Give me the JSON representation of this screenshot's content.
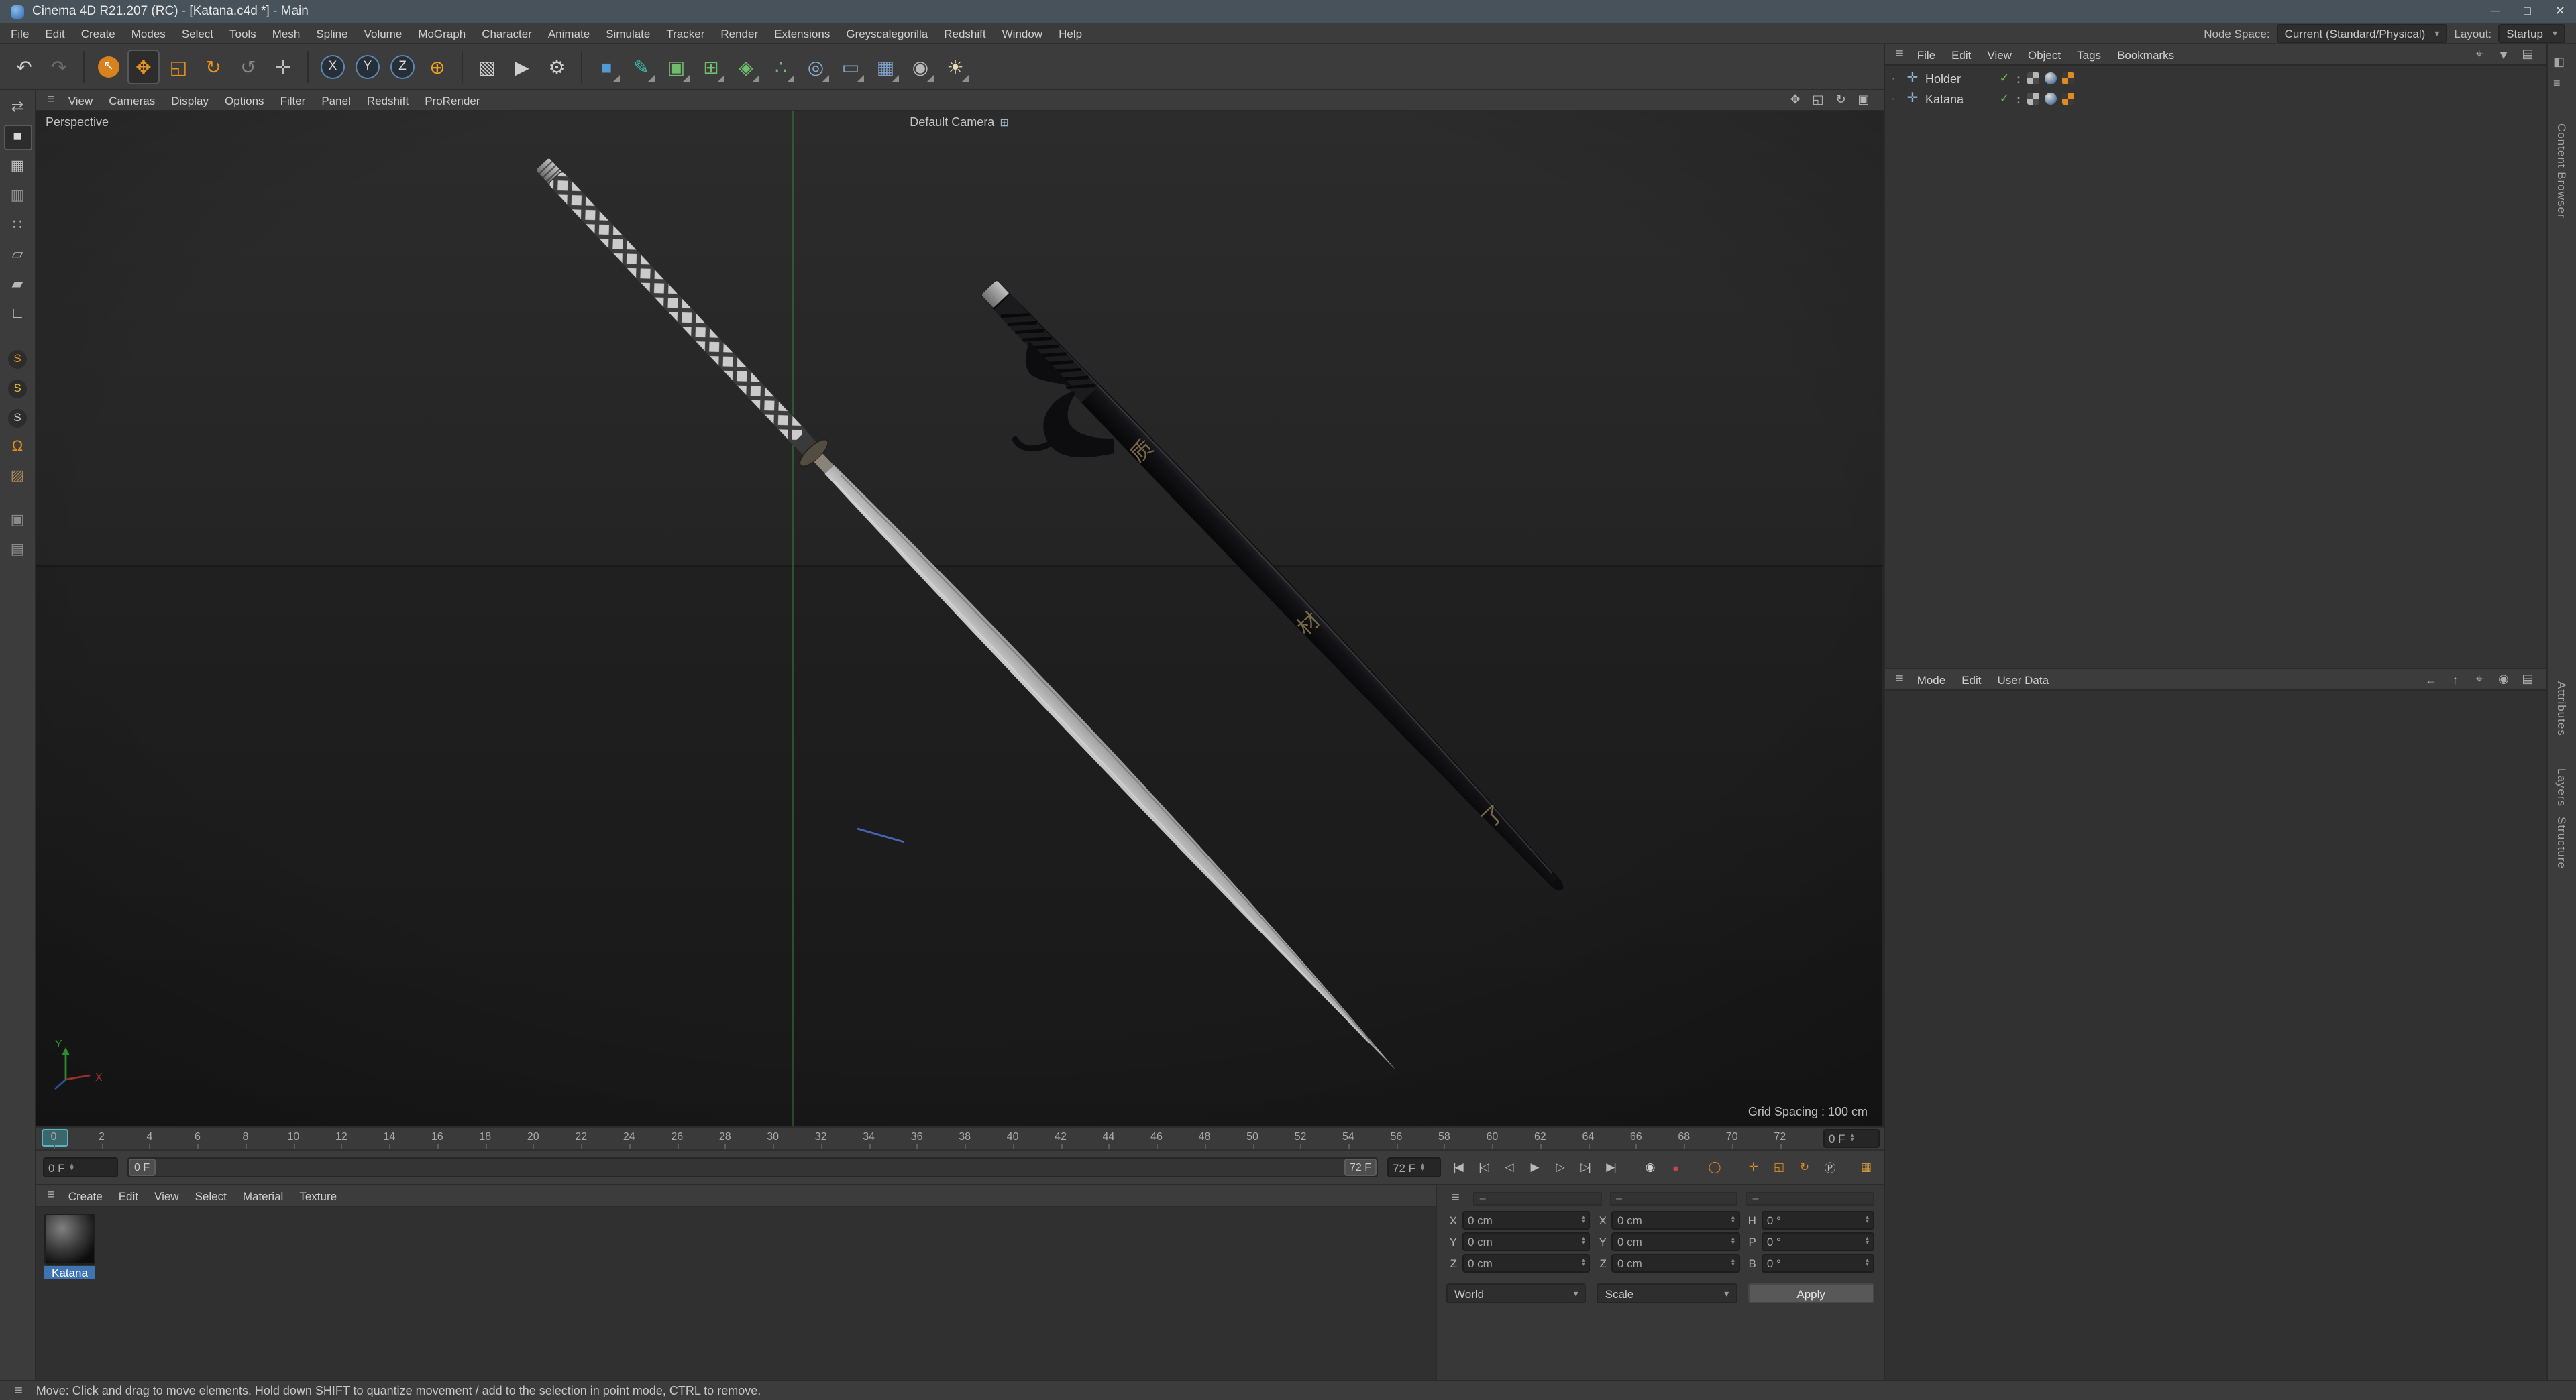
{
  "ui": {
    "hamburger": "≡",
    "dropdown_arrow": "▾",
    "stepper_up": "▴",
    "stepper_down": "▾"
  },
  "titlebar": {
    "title": "Cinema 4D R21.207 (RC) - [Katana.c4d *] - Main",
    "minimize": "─",
    "maximize": "□",
    "close": "✕"
  },
  "menubar": {
    "items": [
      "File",
      "Edit",
      "Create",
      "Modes",
      "Select",
      "Tools",
      "Mesh",
      "Spline",
      "Volume",
      "MoGraph",
      "Character",
      "Animate",
      "Simulate",
      "Tracker",
      "Render",
      "Extensions",
      "Greyscalegorilla",
      "Redshift",
      "Window",
      "Help"
    ],
    "node_space_label": "Node Space:",
    "node_space_value": "Current (Standard/Physical)",
    "layout_label": "Layout:",
    "layout_value": "Startup"
  },
  "toolbar": {
    "icons": [
      {
        "name": "undo-icon",
        "glyph": "↶",
        "fg": "#cfcfcf"
      },
      {
        "name": "redo-icon",
        "glyph": "↷",
        "fg": "#6e6e6e"
      },
      {
        "sep": true
      },
      {
        "name": "live-selection-tool",
        "glyph": "↖",
        "fg": "#ffffff",
        "bg": "#d8821e",
        "shape": "circle"
      },
      {
        "name": "move-tool",
        "glyph": "✥",
        "fg": "#e8921e",
        "active": true
      },
      {
        "name": "scale-tool",
        "glyph": "◱",
        "fg": "#e8921e"
      },
      {
        "name": "rotate-tool",
        "glyph": "↻",
        "fg": "#e8921e"
      },
      {
        "name": "last-tool-used",
        "glyph": "↺",
        "fg": "#868686"
      },
      {
        "name": "modeling-axis-tool",
        "glyph": "✛",
        "fg": "#bdbdbd"
      },
      {
        "sep": true
      },
      {
        "name": "x-axis-lock",
        "glyph": "X",
        "fg": "#d8d8d8",
        "bg": "#262e38",
        "shape": "circle",
        "ring": "#5d87b5"
      },
      {
        "name": "y-axis-lock",
        "glyph": "Y",
        "fg": "#d8d8d8",
        "bg": "#262e38",
        "shape": "circle",
        "ring": "#5d87b5"
      },
      {
        "name": "z-axis-lock",
        "glyph": "Z",
        "fg": "#d8d8d8",
        "bg": "#262e38",
        "shape": "circle",
        "ring": "#5d87b5"
      },
      {
        "name": "coordinate-system-toggle",
        "glyph": "⊕",
        "fg": "#e8a21e"
      },
      {
        "sep": true
      },
      {
        "name": "render-view-button",
        "glyph": "▧",
        "fg": "#cfcfcf"
      },
      {
        "name": "render-picture-viewer-button",
        "glyph": "▶",
        "fg": "#cfcfcf"
      },
      {
        "name": "render-settings-button",
        "glyph": "⚙",
        "fg": "#cfcfcf"
      },
      {
        "sep": true
      },
      {
        "name": "add-cube-primitive",
        "glyph": "■",
        "fg": "#4f9bd5",
        "corner": true
      },
      {
        "name": "spline-pen-tool",
        "glyph": "✎",
        "fg": "#3fb5a8",
        "corner": true
      },
      {
        "name": "subdivision-surface-generator",
        "glyph": "▣",
        "fg": "#71bd6d",
        "corner": true
      },
      {
        "name": "generators-menu",
        "glyph": "⊞",
        "fg": "#71bd6d",
        "corner": true
      },
      {
        "name": "deformers-menu",
        "glyph": "◈",
        "fg": "#71bd6d",
        "corner": true
      },
      {
        "name": "mograph-cloner-menu",
        "glyph": "∴",
        "fg": "#71bd6d",
        "corner": true
      },
      {
        "name": "simulation-menu",
        "glyph": "◎",
        "fg": "#8fa8c8",
        "corner": true
      },
      {
        "name": "volume-builder-menu",
        "glyph": "▭",
        "fg": "#8fa8c8",
        "corner": true
      },
      {
        "name": "floor-object-menu",
        "glyph": "▦",
        "fg": "#7fa0c8",
        "corner": true
      },
      {
        "name": "camera-object-menu",
        "glyph": "◉",
        "fg": "#b8b8b8",
        "corner": true
      },
      {
        "name": "light-object-menu",
        "glyph": "☀",
        "fg": "#e8dfb8",
        "corner": true
      }
    ]
  },
  "left_palette": {
    "icons": [
      {
        "name": "make-editable",
        "glyph": "⇄",
        "fg": "#b8b8b8"
      },
      {
        "name": "model-mode",
        "glyph": "■",
        "fg": "#d8d8d8",
        "active": true
      },
      {
        "name": "texture-mode",
        "glyph": "▦",
        "fg": "#b8b8b8"
      },
      {
        "name": "workplane-mode",
        "glyph": "▥",
        "fg": "#8d8d8d"
      },
      {
        "name": "points-mode",
        "glyph": "∷",
        "fg": "#b8b8b8"
      },
      {
        "name": "edges-mode",
        "glyph": "▱",
        "fg": "#b8b8b8"
      },
      {
        "name": "polygons-mode",
        "glyph": "▰",
        "fg": "#b8b8b8"
      },
      {
        "name": "tweak-mode",
        "glyph": "∟",
        "fg": "#b8b8b8"
      },
      {
        "gap": true
      },
      {
        "name": "snap-settings",
        "glyph": "S",
        "fg": "#e8921e",
        "bg": "#2c2c2c",
        "shape": "circle"
      },
      {
        "name": "snap-modes",
        "glyph": "S",
        "fg": "#e8c23a",
        "bg": "#2c2c2c",
        "shape": "circle"
      },
      {
        "name": "enable-snap",
        "glyph": "S",
        "fg": "#cfcfcf",
        "bg": "#2c2c2c",
        "shape": "circle"
      },
      {
        "name": "snap-magnet",
        "glyph": "Ω",
        "fg": "#e8921e"
      },
      {
        "name": "quantize-toggle",
        "glyph": "▨",
        "fg": "#b08a5a"
      },
      {
        "gap": true
      },
      {
        "name": "isolate-view-toggle",
        "glyph": "▣",
        "fg": "#8a8a8a"
      },
      {
        "name": "lock-workplane-toggle",
        "glyph": "▤",
        "fg": "#8a8a8a"
      }
    ]
  },
  "viewport": {
    "menus": [
      "View",
      "Cameras",
      "Display",
      "Options",
      "Filter",
      "Panel",
      "Redshift",
      "ProRender"
    ],
    "nav_icons": [
      {
        "name": "pan-view-icon",
        "glyph": "✥"
      },
      {
        "name": "zoom-view-icon",
        "glyph": "◱"
      },
      {
        "name": "rotate-view-icon",
        "glyph": "↻"
      },
      {
        "name": "toggle-view-icon",
        "glyph": "▣"
      }
    ],
    "view_label": "Perspective",
    "camera_label": "Default Camera",
    "camera_icon": "⊞",
    "grid_spacing": "Grid Spacing : 100 cm",
    "axis_x": "X",
    "axis_y": "Y",
    "scabbard_kanji": [
      "质",
      "材",
      "了"
    ]
  },
  "timeline": {
    "ruler": {
      "start": 0,
      "end": 72,
      "step": 2,
      "current": 0
    },
    "frame_field": "0 F",
    "current_frame": "0 F",
    "range_start": "0 F",
    "range_end": "72 F",
    "end_frame": "72 F",
    "transport": [
      {
        "name": "goto-start-button",
        "glyph": "|◀"
      },
      {
        "name": "previous-key-button",
        "glyph": "|◁"
      },
      {
        "name": "previous-frame-button",
        "glyph": "◁"
      },
      {
        "name": "play-button",
        "glyph": "▶"
      },
      {
        "name": "next-frame-button",
        "glyph": "▷"
      },
      {
        "name": "next-key-button",
        "glyph": "▷|"
      },
      {
        "name": "goto-end-button",
        "glyph": "▶|"
      },
      {
        "space": 8
      },
      {
        "name": "record-keyframe-button",
        "glyph": "◉",
        "fg": "#d2d2d2"
      },
      {
        "name": "record-button",
        "glyph": "●",
        "fg": "#c84545"
      },
      {
        "space": 8
      },
      {
        "name": "autokey-button",
        "glyph": "◯",
        "fg": "#e07a1e"
      },
      {
        "space": 8
      },
      {
        "name": "key-position-toggle",
        "glyph": "✛",
        "fg": "#e08a20"
      },
      {
        "name": "key-scale-toggle",
        "glyph": "◱",
        "fg": "#e08a20"
      },
      {
        "name": "key-rotation-toggle",
        "glyph": "↻",
        "fg": "#e08a20"
      },
      {
        "name": "key-parameter-toggle",
        "glyph": "Ⓟ",
        "fg": "#c0c0c0"
      },
      {
        "space": "flex"
      },
      {
        "name": "timeline-layout-button",
        "glyph": "▦",
        "fg": "#d89a3a"
      }
    ]
  },
  "material_manager": {
    "menus": [
      "Create",
      "Edit",
      "View",
      "Select",
      "Material",
      "Texture"
    ],
    "materials": [
      {
        "name": "Katana"
      }
    ]
  },
  "coordinates": {
    "headers": [
      "–",
      "–",
      "–"
    ],
    "rows": [
      {
        "pos_label": "X",
        "pos_value": "0 cm",
        "size_label": "X",
        "size_value": "0 cm",
        "rot_label": "H",
        "rot_value": "0 °"
      },
      {
        "pos_label": "Y",
        "pos_value": "0 cm",
        "size_label": "Y",
        "size_value": "0 cm",
        "rot_label": "P",
        "rot_value": "0 °"
      },
      {
        "pos_label": "Z",
        "pos_value": "0 cm",
        "size_label": "Z",
        "size_value": "0 cm",
        "rot_label": "B",
        "rot_value": "0 °"
      }
    ],
    "space_select": "World",
    "size_select": "Scale",
    "apply_button": "Apply"
  },
  "object_manager": {
    "menus": [
      "File",
      "Edit",
      "View",
      "Object",
      "Tags",
      "Bookmarks"
    ],
    "right_icons": [
      {
        "name": "search-icon",
        "glyph": "⌖"
      },
      {
        "name": "filter-icon",
        "glyph": "▼"
      },
      {
        "name": "panel-icon",
        "glyph": "▤"
      }
    ],
    "row_icons": {
      "branch": "∙",
      "object": "✛",
      "check": "✓",
      "dots": ":"
    },
    "objects": [
      {
        "name": "Holder"
      },
      {
        "name": "Katana"
      }
    ]
  },
  "attribute_manager": {
    "menus": [
      "Mode",
      "Edit",
      "User Data"
    ],
    "right_icons": [
      {
        "name": "back-icon",
        "glyph": "←"
      },
      {
        "name": "up-icon",
        "glyph": "↑"
      },
      {
        "name": "search-icon",
        "glyph": "⌖"
      },
      {
        "name": "lock-icon",
        "glyph": "◉"
      },
      {
        "name": "panel-icon",
        "glyph": "▤"
      }
    ]
  },
  "right_strip": {
    "icons": [
      {
        "name": "dock-icon",
        "glyph": "◧"
      },
      {
        "name": "strip-menu-icon",
        "glyph": "≡"
      }
    ],
    "tabs": [
      "Content Browser",
      "Attributes",
      "Layers",
      "Structure"
    ]
  },
  "statusbar": {
    "text": "Move: Click and drag to move elements. Hold down SHIFT to quantize movement / add to the selection in point mode, CTRL to remove."
  }
}
